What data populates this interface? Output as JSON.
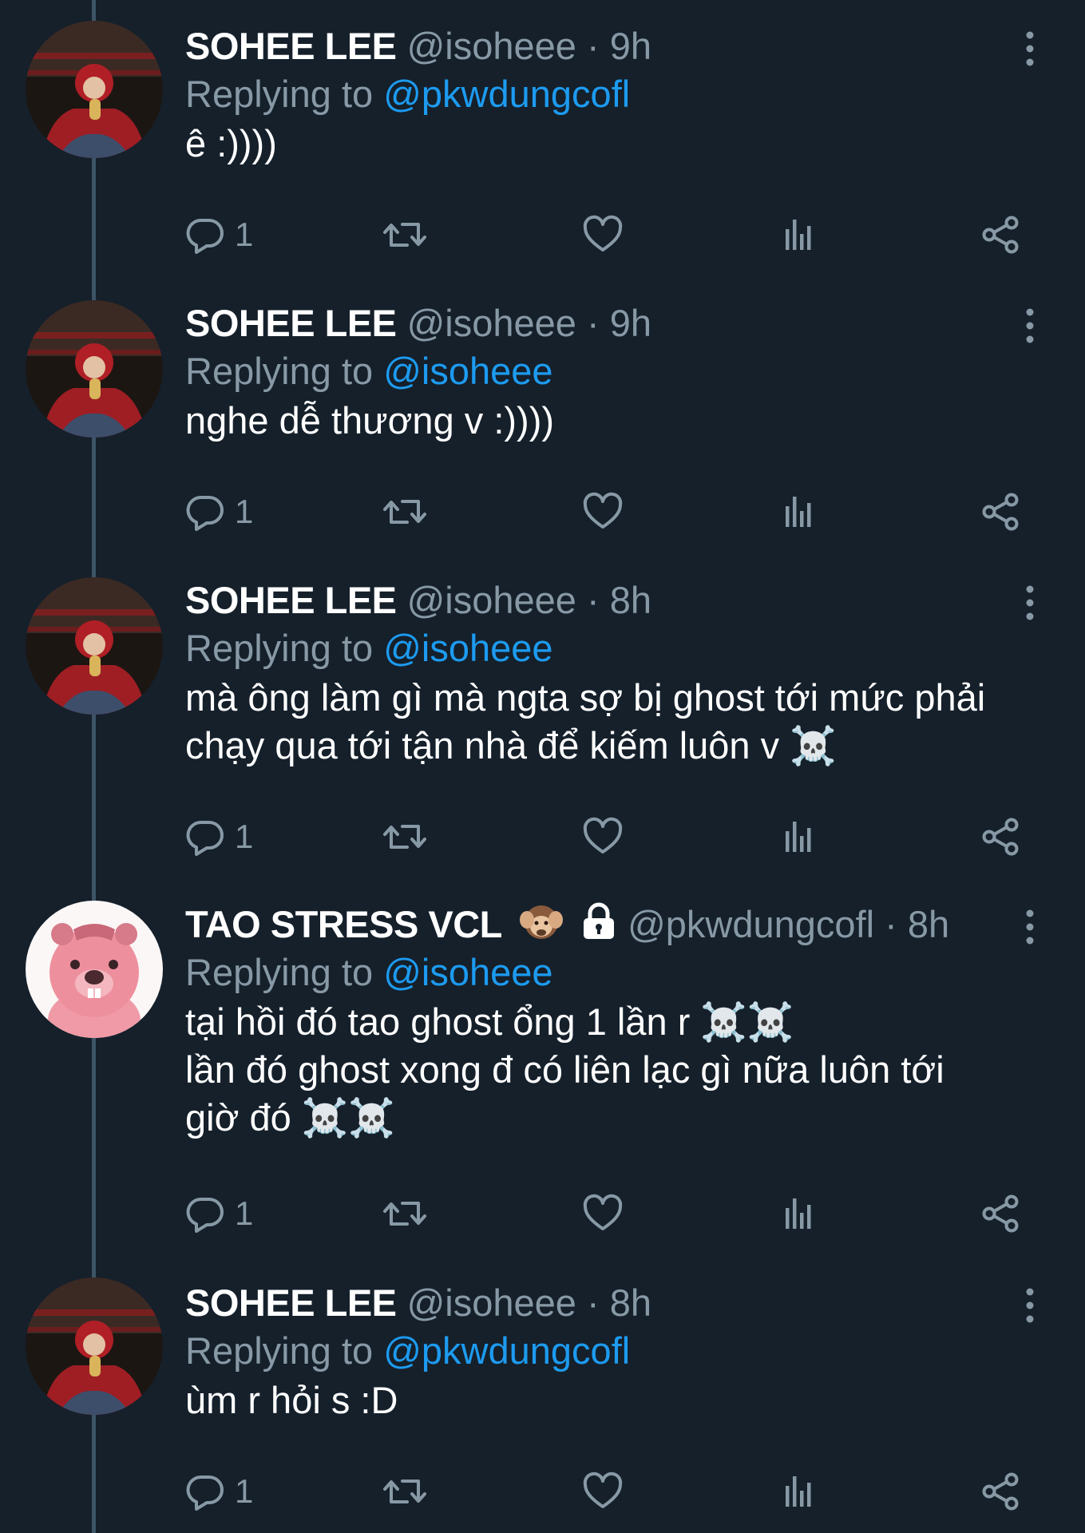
{
  "tweets": [
    {
      "avatar": "sohee-avatar",
      "name": "SOHEE LEE",
      "handle": "@isoheee",
      "separator": "·",
      "time": "9h",
      "replying_prefix": "Replying to",
      "replying_to": "@pkwdungcofl",
      "text": "ê :))))",
      "reply_count": "1"
    },
    {
      "avatar": "sohee-avatar",
      "name": "SOHEE LEE",
      "handle": "@isoheee",
      "separator": "·",
      "time": "9h",
      "replying_prefix": "Replying to",
      "replying_to": "@isoheee",
      "text": "nghe dễ thương v :))))",
      "reply_count": "1"
    },
    {
      "avatar": "sohee-avatar",
      "name": "SOHEE LEE",
      "handle": "@isoheee",
      "separator": "·",
      "time": "8h",
      "replying_prefix": "Replying to",
      "replying_to": "@isoheee",
      "text": "mà ông làm gì mà ngta sợ bị ghost tới mức phải\nchạy qua tới tận nhà để kiếm luôn v ☠️",
      "reply_count": "1"
    },
    {
      "avatar": "pink-beaver-avatar",
      "name": "TAO STRESS VCL",
      "name_badges": [
        "monkey-emoji",
        "lock-icon"
      ],
      "handle": "@pkwdungcofl",
      "separator": "·",
      "time": "8h",
      "replying_prefix": "Replying to",
      "replying_to": "@isoheee",
      "text": "tại hồi đó tao ghost ổng 1 lần r ☠️☠️\nlần đó ghost xong đ có liên lạc gì nữa luôn tới\ngiờ đó ☠️☠️",
      "reply_count": "1"
    },
    {
      "avatar": "sohee-avatar",
      "name": "SOHEE LEE",
      "handle": "@isoheee",
      "separator": "·",
      "time": "8h",
      "replying_prefix": "Replying to",
      "replying_to": "@pkwdungcofl",
      "text": "ùm r hỏi s :D",
      "reply_count": "1"
    }
  ],
  "icons": {
    "reply": "reply-icon",
    "retweet": "retweet-icon",
    "like": "heart-icon",
    "analytics": "analytics-icon",
    "share": "share-icon",
    "more": "more-vertical-icon"
  },
  "colors": {
    "background": "#15202b",
    "secondary_text": "#8899a6",
    "mention": "#1d9bf0",
    "thread_line": "#3d5466"
  }
}
